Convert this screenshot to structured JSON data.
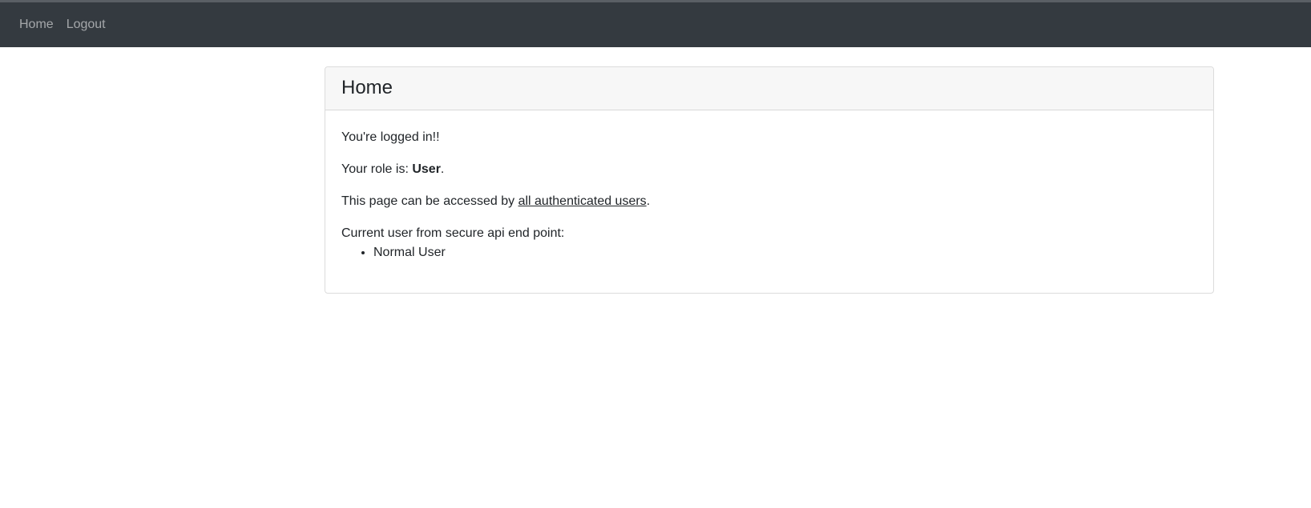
{
  "navbar": {
    "home_label": "Home",
    "logout_label": "Logout"
  },
  "card": {
    "title": "Home",
    "logged_in_text": "You're logged in!!",
    "role_prefix": "Your role is: ",
    "role_value": "User",
    "role_suffix": ".",
    "access_prefix": "This page can be accessed by ",
    "access_link": "all authenticated users",
    "access_suffix": ".",
    "api_label": "Current user from secure api end point:",
    "users": [
      "Normal User"
    ]
  },
  "colors": {
    "navbar_bg": "#343a40",
    "nav_link": "#9a9da0",
    "card_header_bg": "#f7f7f7",
    "card_border": "#dcdcdc",
    "text": "#212529"
  }
}
